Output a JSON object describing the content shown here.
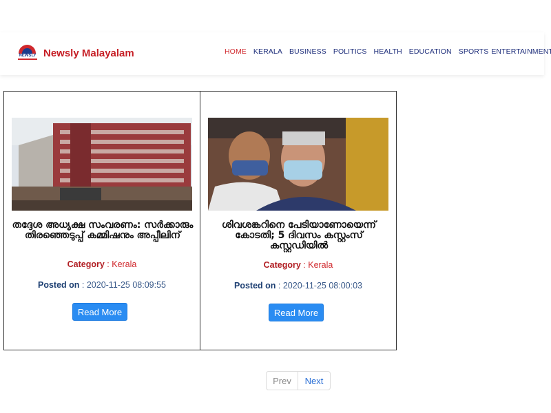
{
  "header": {
    "logo_text": "NEWSLY",
    "brand": "Newsly Malayalam",
    "nav": [
      "HOME",
      "KERALA",
      "BUSINESS",
      "POLITICS",
      "HEALTH",
      "EDUCATION",
      "SPORTS",
      "ENTERTAINMENT"
    ],
    "active_nav": "HOME"
  },
  "articles": [
    {
      "title": "തദ്ദേശ അധ്യക്ഷ സംവരണം: സർക്കാരും തിരഞ്ഞെടുപ്പ് കമ്മിഷനും അപ്പീലിന്",
      "category_label": "Category",
      "category": " : Kerala",
      "posted_label": "Posted on",
      "posted": " : 2020-11-25 08:09:55",
      "button": "Read More",
      "image": "high-court-building-photo"
    },
    {
      "title": "ശിവശങ്കറിനെ പേടിയാണോയെന്ന് കോടതി; 5 ദിവസം കസ്റ്റംസ് കസ്റ്റഡിയിൽ",
      "category_label": "Category",
      "category": " : Kerala",
      "posted_label": "Posted on",
      "posted": " : 2020-11-25 08:00:03",
      "button": "Read More",
      "image": "masked-men-photo"
    }
  ],
  "pagination": {
    "prev": "Prev",
    "next": "Next"
  },
  "colors": {
    "brand_red": "#c61e25",
    "nav_blue": "#1d2d7a",
    "button_blue": "#2a8cf2"
  }
}
